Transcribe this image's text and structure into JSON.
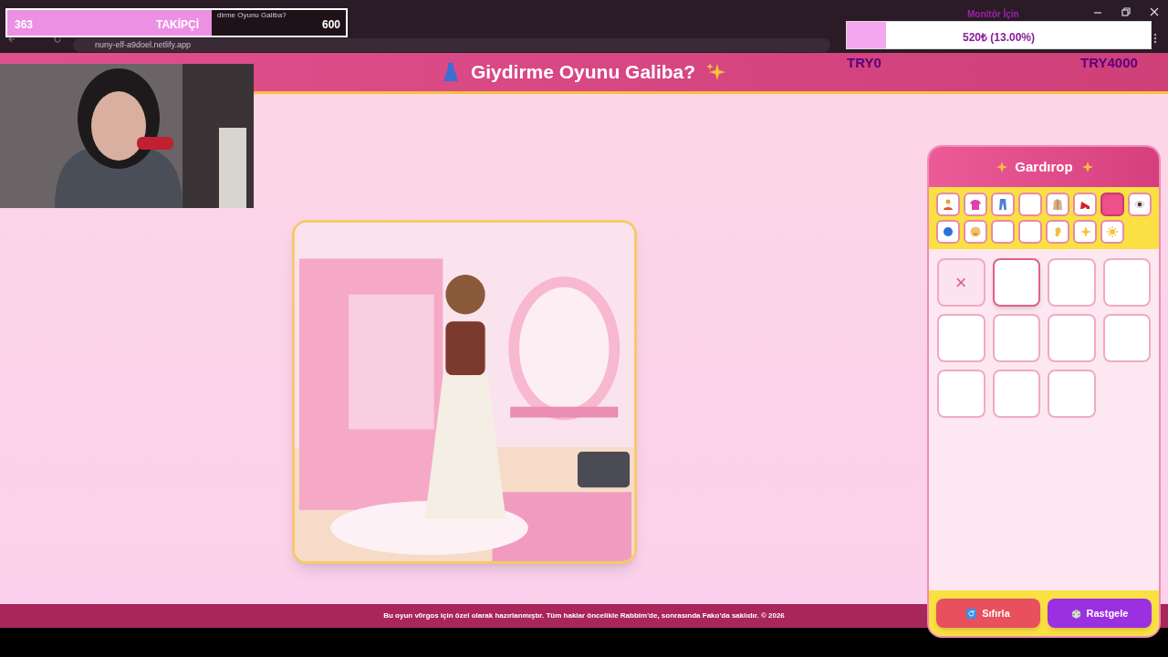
{
  "browser": {
    "tab_title": "dirme Oyunu Galiba?",
    "url": "nuny-elf-a9doel.netlify.app"
  },
  "follower_goal": {
    "current": "363",
    "label": "TAKİPÇİ",
    "target": "600",
    "level": 0.605
  },
  "donation_goal": {
    "title": "Monitör İçin",
    "reading": "520₺ (13.00%)",
    "level": 0.13,
    "min": "TRY0",
    "max": "TRY4000"
  },
  "header": {
    "title": "Giydirme Oyunu **Galiba?**"
  },
  "wardrobe": {
    "title": "Gardırop",
    "categories": [
      {
        "selected": false
      },
      {
        "selected": false
      },
      {
        "selected": false
      },
      {
        "selected": false
      },
      {
        "selected": false
      },
      {
        "selected": false
      },
      {
        "selected": true
      },
      {
        "selected": false
      },
      {
        "selected": false
      },
      {
        "selected": false
      },
      {
        "selected": false
      },
      {
        "selected": false
      },
      {
        "selected": false
      },
      {
        "selected": false
      },
      {
        "selected": false
      }
    ],
    "items": [
      {
        "kind": "none",
        "symbol": "×",
        "selected": false
      },
      {
        "kind": "empty",
        "selected": true
      },
      {
        "kind": "empty",
        "selected": false
      },
      {
        "kind": "empty",
        "selected": false
      },
      {
        "kind": "empty",
        "selected": false
      },
      {
        "kind": "empty",
        "selected": false
      },
      {
        "kind": "empty",
        "selected": false
      },
      {
        "kind": "empty",
        "selected": false
      },
      {
        "kind": "empty",
        "selected": false
      },
      {
        "kind": "empty",
        "selected": false
      },
      {
        "kind": "empty",
        "selected": false
      }
    ],
    "buttons": [
      {
        "kind": "reset",
        "label": "Sıfırla"
      },
      {
        "kind": "random",
        "label": "Rastgele"
      }
    ]
  },
  "footer": "Bu oyun **v0rgos** için özel olarak hazırlanmıştır. Tüm haklar öncelikle **Rabbim**'de, sonrasında **Fako**'da saklıdır. © 2026"
}
